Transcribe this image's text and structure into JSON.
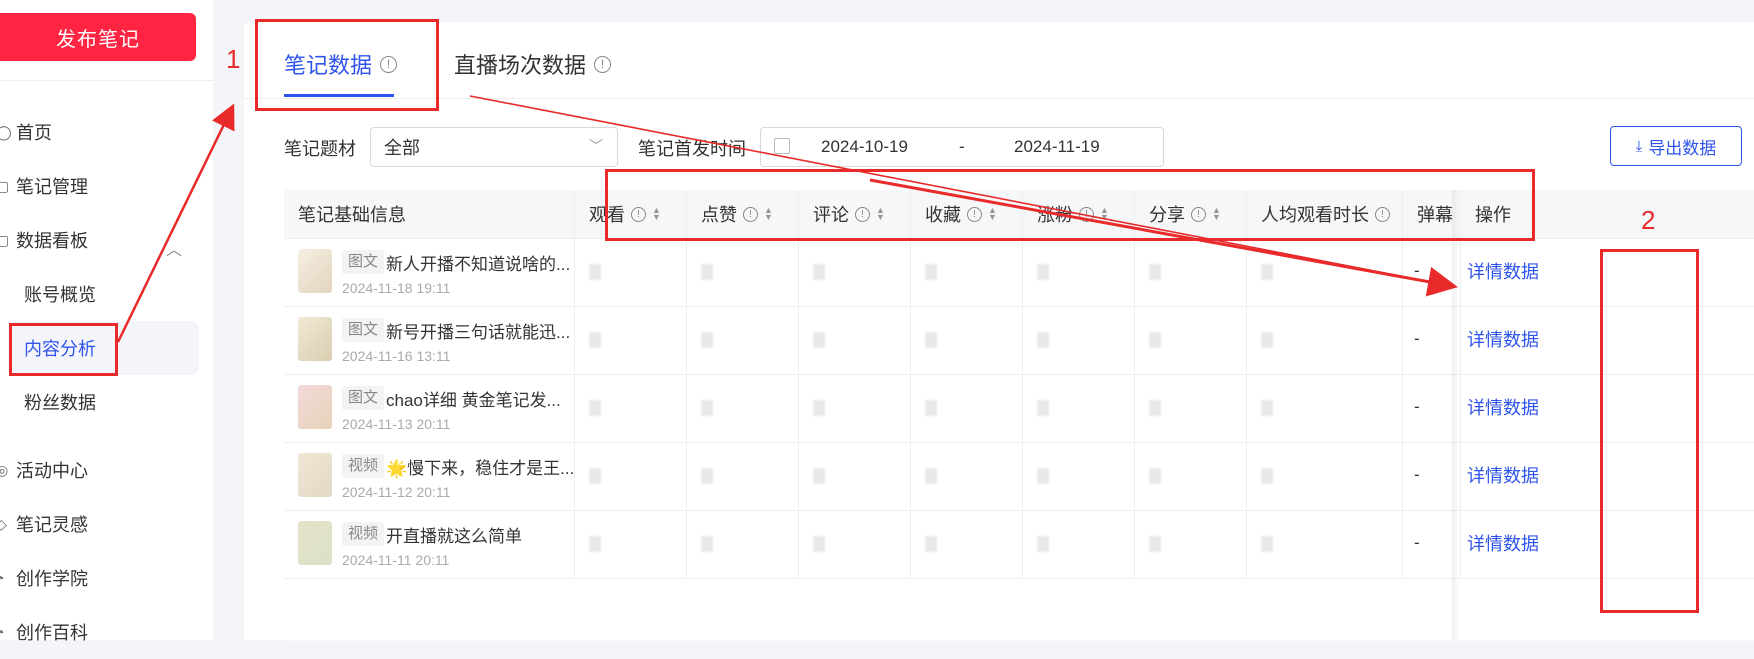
{
  "sidebar": {
    "publish_label": "发布笔记",
    "items": [
      {
        "label": "首页",
        "icon": "home-icon"
      },
      {
        "label": "笔记管理",
        "icon": "note-icon"
      },
      {
        "label": "数据看板",
        "icon": "chart-icon"
      },
      {
        "label": "账号概览"
      },
      {
        "label": "内容分析"
      },
      {
        "label": "粉丝数据"
      },
      {
        "label": "活动中心",
        "icon": "activity-icon"
      },
      {
        "label": "笔记灵感",
        "icon": "bulb-icon"
      },
      {
        "label": "创作学院",
        "icon": "school-icon"
      },
      {
        "label": "创作百科",
        "icon": "book-icon"
      }
    ]
  },
  "tabs": [
    {
      "label": "笔记数据",
      "active": true
    },
    {
      "label": "直播场次数据",
      "active": false
    }
  ],
  "filters": {
    "topic_label": "笔记题材",
    "topic_value": "全部",
    "time_label": "笔记首发时间",
    "date_start": "2024-10-19",
    "date_sep": "-",
    "date_end": "2024-11-19",
    "export_label": "导出数据"
  },
  "table": {
    "headers": {
      "basic": "笔记基础信息",
      "views": "观看",
      "likes": "点赞",
      "comments": "评论",
      "favorites": "收藏",
      "followers": "涨粉",
      "shares": "分享",
      "avg_watch": "人均观看时长",
      "danmaku": "弹幕",
      "ops": "操作"
    },
    "rows": [
      {
        "tag": "图文",
        "title": "新人开播不知道说啥的...",
        "date": "2024-11-18 19:11",
        "danmaku": "-",
        "action": "详情数据"
      },
      {
        "tag": "图文",
        "title": "新号开播三句话就能迅...",
        "date": "2024-11-16 13:11",
        "danmaku": "-",
        "action": "详情数据"
      },
      {
        "tag": "图文",
        "title": "chao详细 黄金笔记发...",
        "date": "2024-11-13 20:11",
        "danmaku": "-",
        "action": "详情数据"
      },
      {
        "tag": "视频",
        "title": "🌟慢下来，稳住才是王...",
        "date": "2024-11-12 20:11",
        "danmaku": "-",
        "action": "详情数据"
      },
      {
        "tag": "视频",
        "title": "开直播就这么简单",
        "date": "2024-11-11 20:11",
        "danmaku": "-",
        "action": "详情数据"
      }
    ]
  },
  "annotations": {
    "label1": "1",
    "label2": "2",
    "color": "#e82a2a"
  },
  "colors": {
    "accent": "#2f54eb",
    "brand": "#ff2442"
  }
}
